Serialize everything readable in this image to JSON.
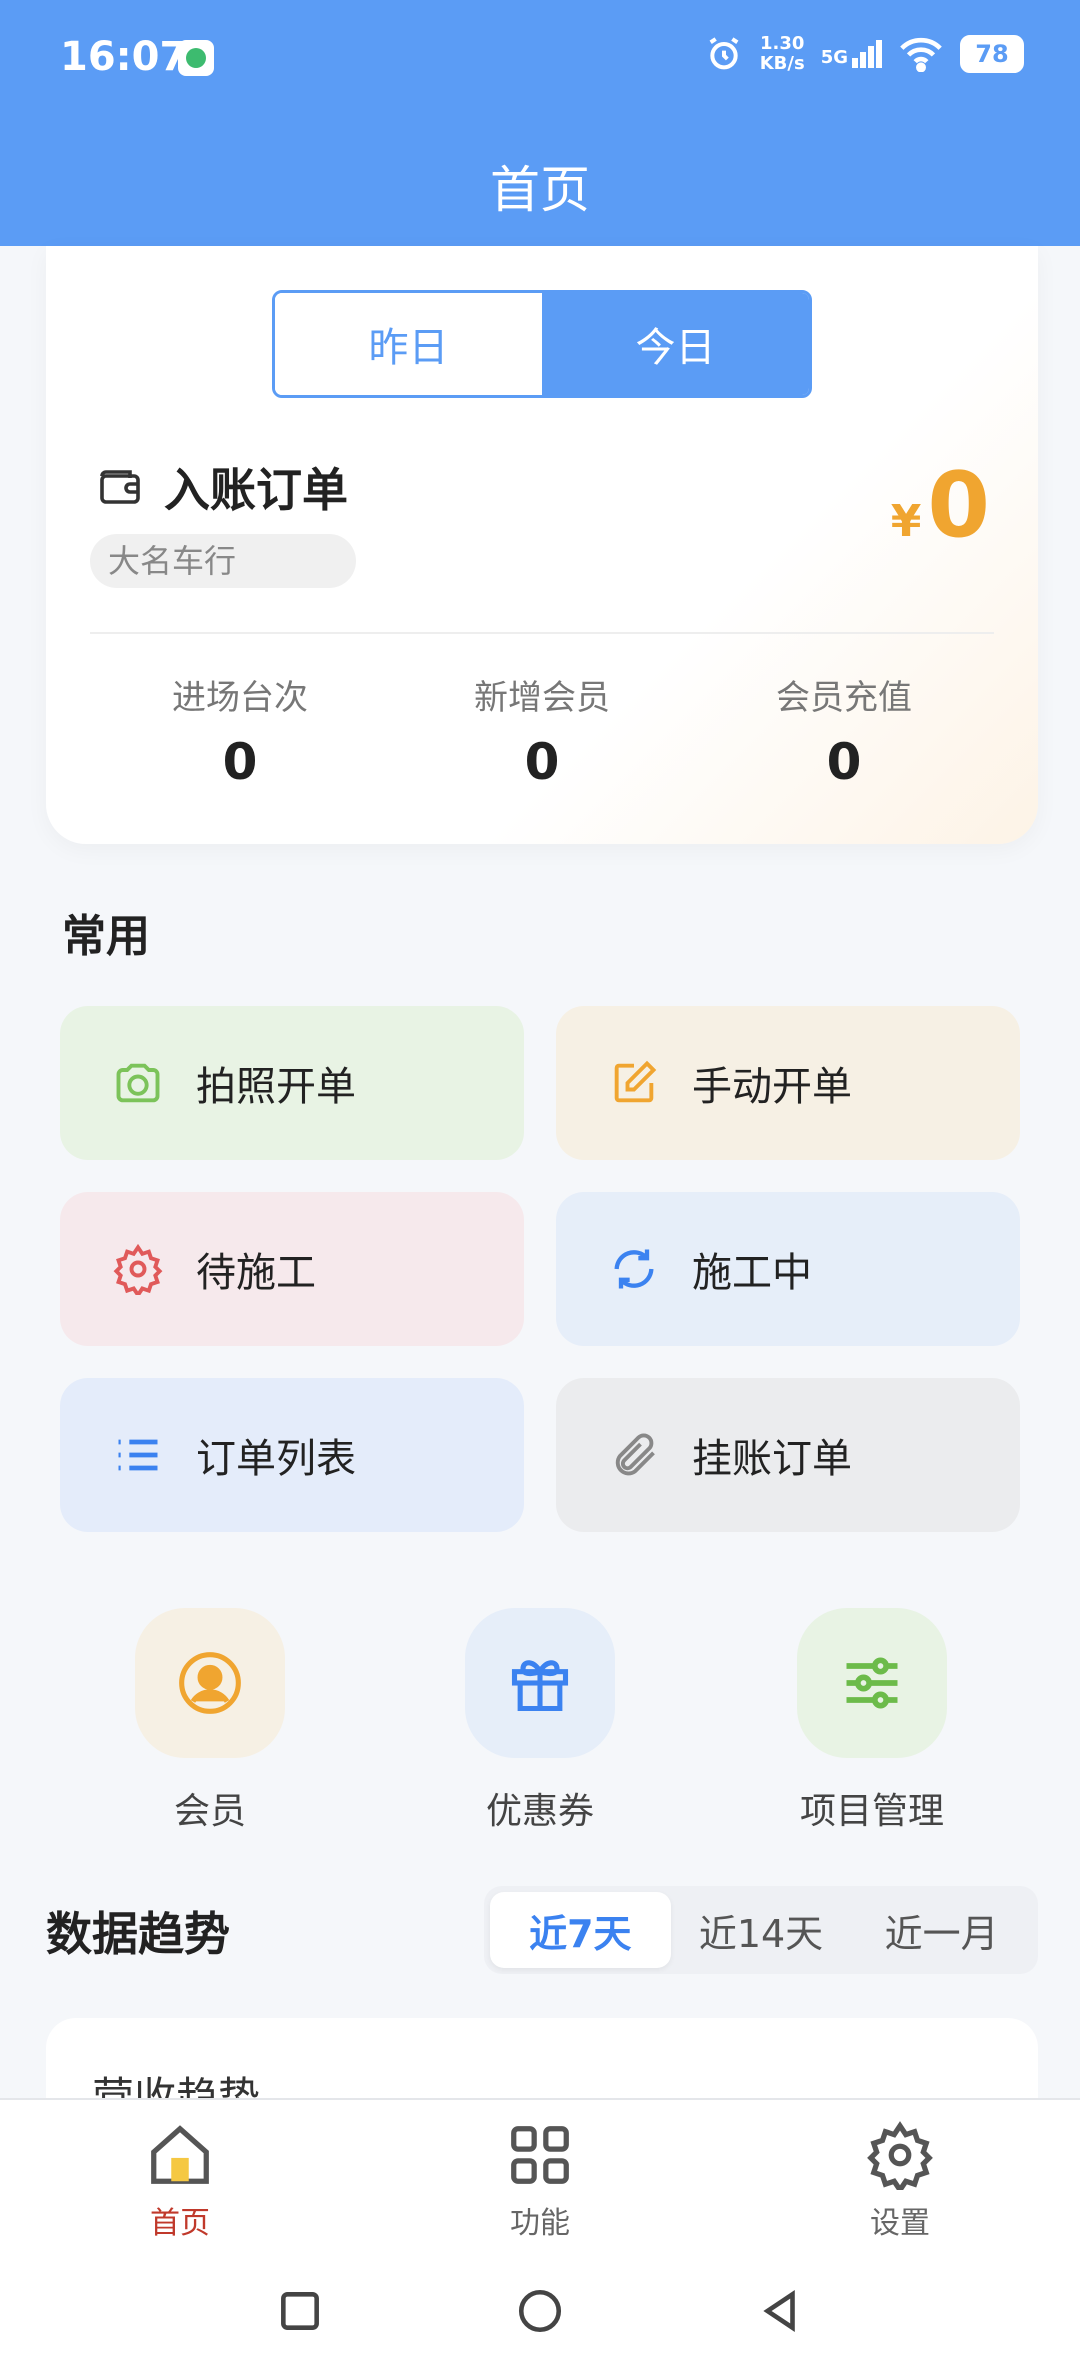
{
  "status_bar": {
    "time": "16:07",
    "net_speed_value": "1.30",
    "net_speed_unit": "KB/s",
    "network": "5G",
    "battery": "78"
  },
  "header": {
    "title": "首页"
  },
  "summary": {
    "tabs": [
      "昨日",
      "今日"
    ],
    "active_tab": "今日",
    "title": "入账订单",
    "shop": "大名车行",
    "currency": "¥",
    "amount": "0",
    "stats": [
      {
        "label": "进场台次",
        "value": "0"
      },
      {
        "label": "新增会员",
        "value": "0"
      },
      {
        "label": "会员充值",
        "value": "0"
      }
    ]
  },
  "common": {
    "title": "常用",
    "tiles": [
      {
        "label": "拍照开单",
        "icon": "camera-icon",
        "color": "#7cc35a",
        "bg": "#e8f3e4"
      },
      {
        "label": "手动开单",
        "icon": "edit-icon",
        "color": "#f0a530",
        "bg": "#f6f0e4"
      },
      {
        "label": "待施工",
        "icon": "gear-icon",
        "color": "#e05a5a",
        "bg": "#f6e9ec"
      },
      {
        "label": "施工中",
        "icon": "refresh-icon",
        "color": "#3b82f0",
        "bg": "#e6eef9"
      },
      {
        "label": "订单列表",
        "icon": "list-icon",
        "color": "#3b82f0",
        "bg": "#e4ecfa"
      },
      {
        "label": "挂账订单",
        "icon": "paperclip-icon",
        "color": "#888888",
        "bg": "#ebecee"
      }
    ]
  },
  "shortcuts": [
    {
      "label": "会员",
      "icon": "user-icon",
      "color": "#f0a530",
      "bg": "#f6f0e4"
    },
    {
      "label": "优惠券",
      "icon": "gift-icon",
      "color": "#3b82f0",
      "bg": "#e6eef9"
    },
    {
      "label": "项目管理",
      "icon": "sliders-icon",
      "color": "#6cbb4a",
      "bg": "#e8f3e4"
    }
  ],
  "trend": {
    "title": "数据趋势",
    "tabs": [
      "近7天",
      "近14天",
      "近一月"
    ],
    "active_tab": "近7天",
    "chart_title": "营收趋势"
  },
  "bottom_nav": {
    "items": [
      {
        "label": "首页",
        "icon": "home-icon"
      },
      {
        "label": "功能",
        "icon": "grid-icon"
      },
      {
        "label": "设置",
        "icon": "settings-icon"
      }
    ],
    "active": "首页"
  }
}
